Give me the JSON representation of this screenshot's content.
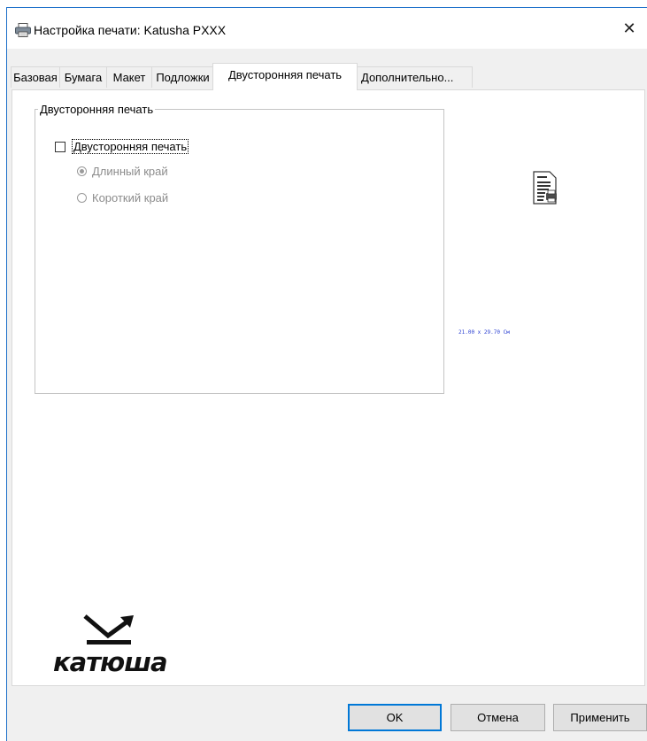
{
  "window": {
    "title": "Настройка печати: Katusha PXXX",
    "close_symbol": "✕",
    "title_icon": "printer-icon"
  },
  "tabs": [
    {
      "label": "Базовая"
    },
    {
      "label": "Бумага"
    },
    {
      "label": "Макет"
    },
    {
      "label": "Подложки"
    },
    {
      "label": "Двусторонняя печать",
      "active": true
    },
    {
      "label": "Дополнительно..."
    }
  ],
  "duplex": {
    "group_title": "Двусторонняя печать",
    "checkbox_label": "Двусторонняя печать",
    "checkbox_checked": false,
    "options": [
      {
        "label": "Длинный край",
        "selected": true,
        "enabled": false
      },
      {
        "label": "Короткий край",
        "selected": false,
        "enabled": false
      }
    ]
  },
  "preview": {
    "icon": "document-printer-icon",
    "paper_size": "21.00 x 29.70 См"
  },
  "logo": {
    "text": "катюша",
    "icon": "katusha-logo"
  },
  "buttons": {
    "ok": "OK",
    "cancel": "Отмена",
    "apply": "Применить"
  },
  "colors": {
    "window_border": "#1b6fc9",
    "dialog_bg": "#f0f0f0",
    "paper_size_text": "#2a3fd1",
    "default_button_border": "#0078d7"
  }
}
